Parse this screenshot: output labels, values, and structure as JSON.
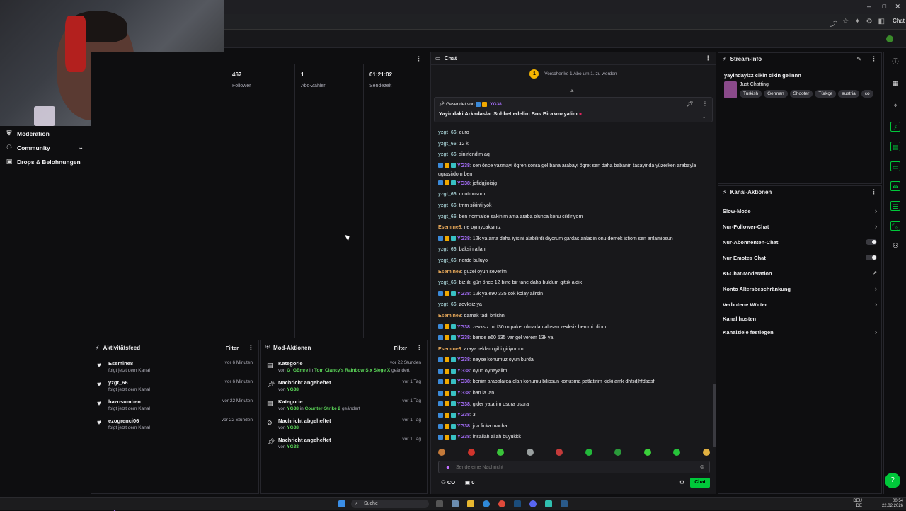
{
  "browser": {
    "tab_label": "Chat",
    "window_controls": [
      "–",
      "□",
      "✕"
    ]
  },
  "sidebar": {
    "items": [
      {
        "label": "Moderation",
        "icon": "shield-icon"
      },
      {
        "label": "Community",
        "icon": "people-icon"
      },
      {
        "label": "Drops & Belohnungen",
        "icon": "gift-icon"
      }
    ]
  },
  "stats": [
    {
      "value": "467",
      "label": "Follower"
    },
    {
      "value": "1",
      "label": "Abo-Zähler"
    },
    {
      "value": "01:21:02",
      "label": "Sendezeit"
    }
  ],
  "activity_feed": {
    "title": "Aktivitätsfeed",
    "filter_label": "Filter",
    "items": [
      {
        "name": "Esemine8",
        "sub": "folgt jetzt dem Kanal",
        "time": "vor 6 Minuten"
      },
      {
        "name": "yzgt_66",
        "sub": "folgt jetzt dem Kanal",
        "time": "vor 6 Minuten"
      },
      {
        "name": "hazosumben",
        "sub": "folgt jetzt dem Kanal",
        "time": "vor 22 Minuten"
      },
      {
        "name": "ezogrenci06",
        "sub": "folgt jetzt dem Kanal",
        "time": "vor 22 Stunden"
      }
    ]
  },
  "mod_actions": {
    "title": "Mod-Aktionen",
    "filter_label": "Filter",
    "items": [
      {
        "title": "Kategorie",
        "prefix": "von",
        "user": "G_GEmre",
        "mid": "in",
        "target": "Tom Clancy's Rainbow Six Siege X",
        "suffix": "geändert",
        "time": "vor 22 Stunden",
        "icon": "category-icon"
      },
      {
        "title": "Nachricht angeheftet",
        "prefix": "von",
        "user": "YG38",
        "mid": "",
        "target": "",
        "suffix": "",
        "time": "vor 1 Tag",
        "icon": "pin-icon"
      },
      {
        "title": "Kategorie",
        "prefix": "von",
        "user": "YG38",
        "mid": "in",
        "target": "Counter-Strike 2",
        "suffix": "geändert",
        "time": "vor 1 Tag",
        "icon": "category-icon"
      },
      {
        "title": "Nachricht abgeheftet",
        "prefix": "von",
        "user": "YG38",
        "mid": "",
        "target": "",
        "suffix": "",
        "time": "vor 1 Tag",
        "icon": "unpin-icon"
      },
      {
        "title": "Nachricht angeheftet",
        "prefix": "von",
        "user": "YG38",
        "mid": "",
        "target": "",
        "suffix": "",
        "time": "vor 1 Tag",
        "icon": "pin-icon"
      }
    ]
  },
  "chat": {
    "title": "Chat",
    "gift_text": "Verschenke 1 Abo um 1. zu werden",
    "gift_count": "1",
    "pinned": {
      "meta": "Gesendet von",
      "user": "YG38",
      "message": "Yayindaki Arkadaslar Sohbet edelim Bos Birakmayalim"
    },
    "messages": [
      {
        "user": "yzgt_66",
        "type": "yz",
        "text": "euro"
      },
      {
        "user": "yzgt_66",
        "type": "yz",
        "text": "12 k"
      },
      {
        "user": "yzgt_66",
        "type": "yz",
        "text": "sinirlendim aq"
      },
      {
        "user": "YG38",
        "type": "yg",
        "text": "sen önce yazmayi ögren sonra gel bana arabayi ögret sen daha babanin tasayinda yüzerken arabayla ugrasiıdom ben",
        "wrap": true
      },
      {
        "user": "YG38",
        "type": "yg",
        "text": "jofidgjjoisjg"
      },
      {
        "user": "yzgt_66",
        "type": "yz",
        "text": "unutmusum"
      },
      {
        "user": "yzgt_66",
        "type": "yz",
        "text": "tmm sikinti yok"
      },
      {
        "user": "yzgt_66",
        "type": "yz",
        "text": "ben normalde sakinim ama araba olunca konu cildiriyom"
      },
      {
        "user": "Esemine8",
        "type": "es",
        "text": "ne oynıycaksınız"
      },
      {
        "user": "YG38",
        "type": "yg",
        "text": "12k ya ama daha iyisini alabilirdi diyorum gardas anladin onu demek istiom sen anlamiosun"
      },
      {
        "user": "yzgt_66",
        "type": "yz",
        "text": "baksin allani"
      },
      {
        "user": "yzgt_66",
        "type": "yz",
        "text": "nerde buluyo"
      },
      {
        "user": "Esemine8",
        "type": "es",
        "text": "güzel oyun severim"
      },
      {
        "user": "yzgt_66",
        "type": "yz",
        "text": "biz iki gün önce 12 bine bir tane daha buldum gittik aldik"
      },
      {
        "user": "YG38",
        "type": "yg",
        "text": "12k ya e90 335 cok kolay alirsin"
      },
      {
        "user": "yzgt_66",
        "type": "yz",
        "text": "zevksiz ya"
      },
      {
        "user": "Esemine8",
        "type": "es",
        "text": "damak tadı bnlshn"
      },
      {
        "user": "YG38",
        "type": "yg",
        "text": "zevksiz mi f30 m paket olmadan alirsan zevksiz ben mi oliom"
      },
      {
        "user": "YG38",
        "type": "yg",
        "text": "bende e60 535 var gel verem 13k ya"
      },
      {
        "user": "Esemine8",
        "type": "es",
        "text": "araya reklam gibi giriyorum"
      },
      {
        "user": "YG38",
        "type": "yg",
        "text": "neyse konumuz oyun burda"
      },
      {
        "user": "YG38",
        "type": "yg",
        "text": "oyun oynayalim"
      },
      {
        "user": "YG38",
        "type": "yg",
        "text": "benim arabalarda olan konumu biliosun konusma patlatirim kicki amk dhfsdjhfdsdsf"
      },
      {
        "user": "YG38",
        "type": "yg",
        "text": "ban la lan"
      },
      {
        "user": "YG38",
        "type": "yg",
        "text": "gider yatarim osura osura"
      },
      {
        "user": "YG38",
        "type": "yg",
        "text": "3"
      },
      {
        "user": "YG38",
        "type": "yg",
        "text": "joa ficka macha"
      },
      {
        "user": "YG38",
        "type": "yg",
        "text": "insallah allah büyükkk"
      }
    ],
    "input_placeholder": "Sende eine Nachricht",
    "points": "CO",
    "gift_icon_count": "0",
    "send_label": "Chat"
  },
  "stream_info": {
    "title": "Stream-Info",
    "stream_title": "yayindayizz cikin cikin gelinnn",
    "category": "Just Chatting",
    "tags": [
      "Turkish",
      "German",
      "Shooter",
      "Türkçe",
      "austria",
      "co"
    ]
  },
  "channel_actions": {
    "title": "Kanal-Aktionen",
    "items": [
      {
        "label": "Slow-Mode",
        "control": "arrow"
      },
      {
        "label": "Nur-Follower-Chat",
        "control": "arrow"
      },
      {
        "label": "Nur-Abonnenten-Chat",
        "control": "toggle"
      },
      {
        "label": "Nur Emotes Chat",
        "control": "toggle"
      },
      {
        "label": "KI-Chat-Moderation",
        "control": "external"
      },
      {
        "label": "Konto Altersbeschränkung",
        "control": "arrow"
      },
      {
        "label": "Verbotene Wörter",
        "control": "arrow"
      },
      {
        "label": "Kanal hosten",
        "control": "none"
      },
      {
        "label": "Kanalziele festlegen",
        "control": "arrow"
      }
    ]
  },
  "taskbar": {
    "search_label": "Suche",
    "lang_top": "DEU",
    "lang_bottom": "DE",
    "time": "00:54",
    "date": "22.02.2026"
  },
  "overlay_ghost": "YG38: insallah allah büyükkk",
  "colors": {
    "accent_green": "#00c83a",
    "user_yg": "#a970ff",
    "user_yz": "#9ac0c4",
    "user_es": "#e6a85a",
    "mod_user": "#5cd85a"
  }
}
